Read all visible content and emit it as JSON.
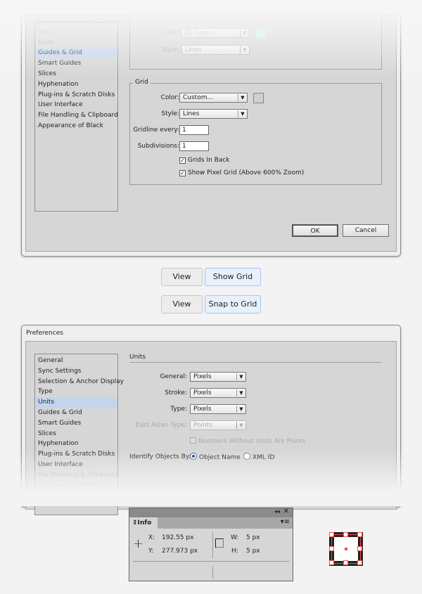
{
  "top_dialog": {
    "sidebar": [
      "Selection & Anchor Display",
      "Type",
      "Units",
      "Guides & Grid",
      "Smart Guides",
      "Slices",
      "Hyphenation",
      "Plug-ins & Scratch Disks",
      "User Interface",
      "File Handling & Clipboard",
      "Appearance of Black"
    ],
    "selected": "Guides & Grid",
    "guides": {
      "color_label": "Color:",
      "color_value": "Cyan",
      "style_label": "Style:",
      "style_value": "Lines",
      "swatch": "#c9f3f3"
    },
    "grid": {
      "title": "Grid",
      "color_label": "Color:",
      "color_value": "Custom...",
      "swatch": "#cfcfcf",
      "style_label": "Style:",
      "style_value": "Lines",
      "gridline_label": "Gridline every:",
      "gridline_value": "1",
      "subdiv_label": "Subdivisions:",
      "subdiv_value": "1",
      "grids_in_back": "Grids In Back",
      "grids_in_back_checked": true,
      "pixel_grid": "Show Pixel Grid (Above 600% Zoom)",
      "pixel_grid_checked": true
    },
    "ok": "OK",
    "cancel": "Cancel"
  },
  "menu_steps": [
    {
      "menu": "View",
      "item": "Show Grid"
    },
    {
      "menu": "View",
      "item": "Snap to Grid"
    }
  ],
  "bottom_dialog": {
    "title": "Preferences",
    "sidebar": [
      "General",
      "Sync Settings",
      "Selection & Anchor Display",
      "Type",
      "Units",
      "Guides & Grid",
      "Smart Guides",
      "Slices",
      "Hyphenation",
      "Plug-ins & Scratch Disks",
      "User Interface",
      "File Handling & Clipboard",
      "Appearance of Black"
    ],
    "selected": "Units",
    "section": "Units",
    "general_label": "General:",
    "general_value": "Pixels",
    "stroke_label": "Stroke:",
    "stroke_value": "Pixels",
    "type_label": "Type:",
    "type_value": "Pixels",
    "east_label": "East Asian Type:",
    "east_value": "Points",
    "numbers_label": "Numbers Without Units Are Points",
    "identify_label": "Identify Objects By:",
    "opt_object": "Object Name",
    "opt_xml": "XML ID",
    "identify_selected": "Object Name"
  },
  "info_panel": {
    "tab": "Info",
    "x_label": "X:",
    "x_value": "192.55 px",
    "y_label": "Y:",
    "y_value": "277.973 px",
    "w_label": "W:",
    "w_value": "5 px",
    "h_label": "H:",
    "h_value": "5 px"
  },
  "colors": {
    "selection": "#c3d5ee",
    "accent_red": "#ff4a4a"
  }
}
